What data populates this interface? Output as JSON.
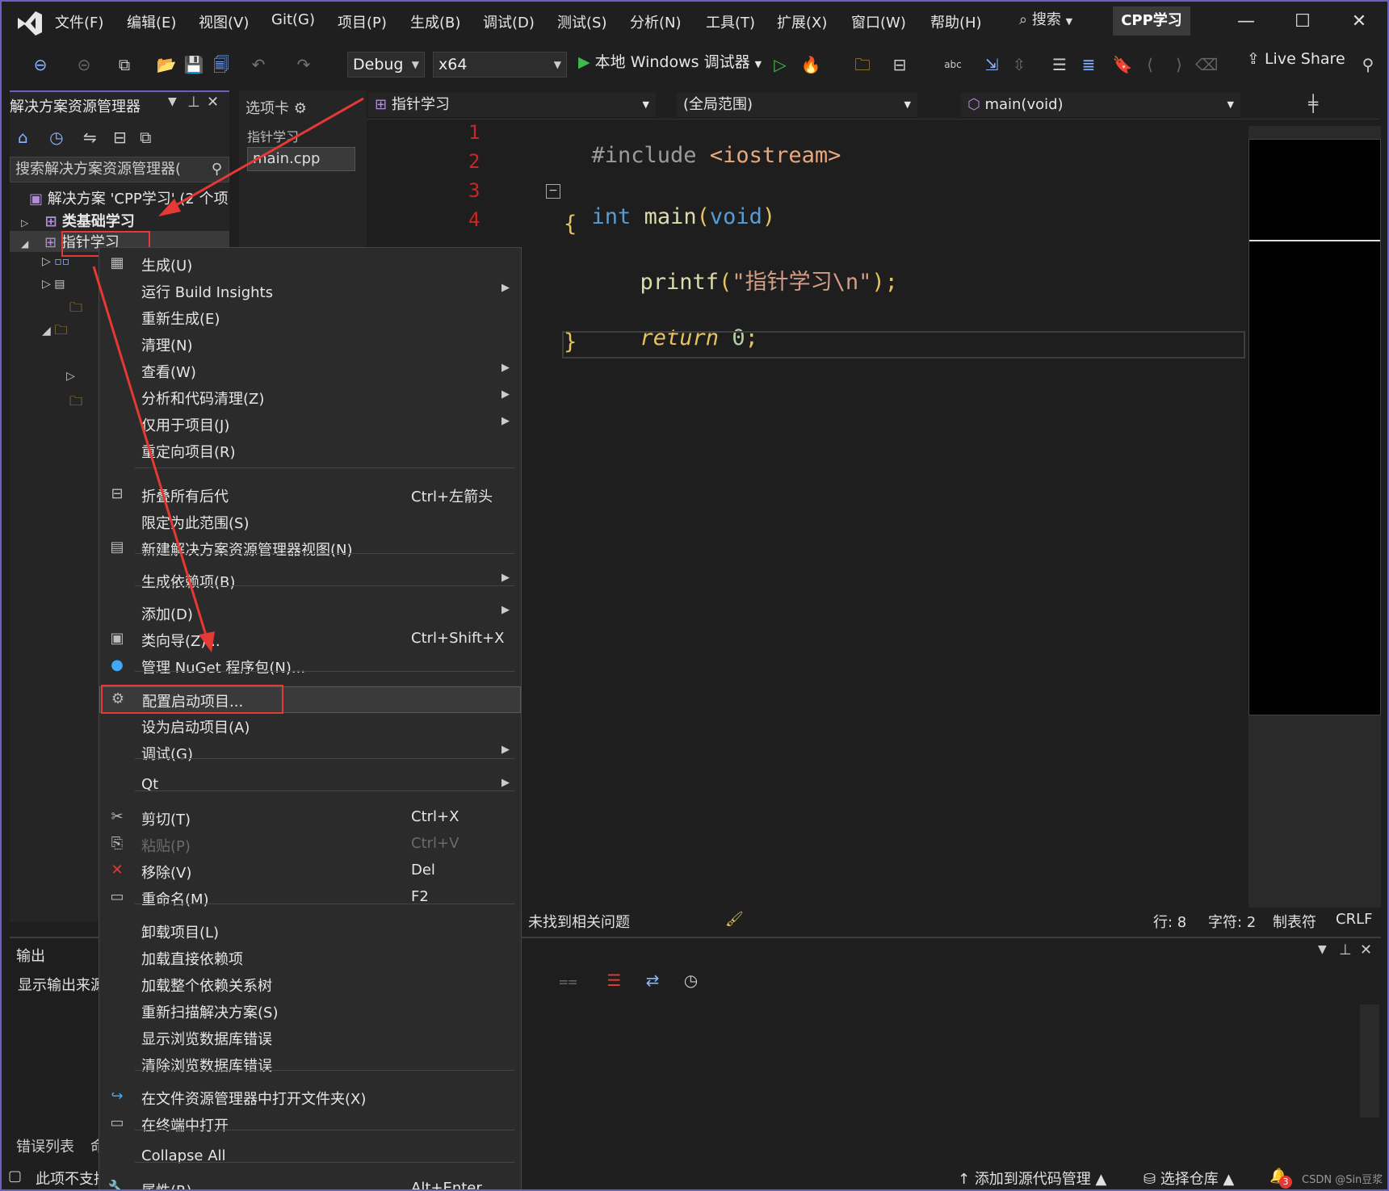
{
  "menu": [
    "文件(F)",
    "编辑(E)",
    "视图(V)",
    "Git(G)",
    "项目(P)",
    "生成(B)",
    "调试(D)",
    "测试(S)",
    "分析(N)",
    "工具(T)",
    "扩展(X)",
    "窗口(W)",
    "帮助(H)"
  ],
  "search_label": "搜索",
  "project_badge": "CPP学习",
  "toolbar": {
    "config": "Debug",
    "platform": "x64",
    "run_label": "本地 Windows 调试器",
    "live_share": "Live Share"
  },
  "solution_explorer": {
    "title": "解决方案资源管理器",
    "search_placeholder": "搜索解决方案资源管理器(",
    "solution_label": "解决方案 'CPP学习' (2 个项",
    "project1": "类基础学习",
    "project2": "指针学习"
  },
  "tab_panel": {
    "title": "选项卡",
    "group": "指针学习",
    "file": "main.cpp"
  },
  "nav": {
    "file": "指针学习",
    "scope": "(全局范围)",
    "member": "main(void)"
  },
  "code": {
    "line1_directive": "#include",
    "line1_header": "<iostream>",
    "line3_kw": "int",
    "line3_fn": "main",
    "line3_param": "void",
    "line4": "{",
    "line5_fn": "printf",
    "line5_str": "\"指针学习\\n\"",
    "line7_kw": "return",
    "line7_num": "0",
    "line8": "}",
    "line_numbers": [
      "1",
      "2",
      "3",
      "4"
    ]
  },
  "editor_status": {
    "issues": "未找到相关问题",
    "line": "行: 8",
    "char": "字符: 2",
    "tab": "制表符",
    "eol": "CRLF"
  },
  "output": {
    "title": "输出",
    "source_label": "显示输出来源"
  },
  "bottom_tabs": [
    "错误列表",
    "命"
  ],
  "statusbar": {
    "left": "此项不支持",
    "add_source": "添加到源代码管理",
    "select_repo": "选择仓库",
    "notif_count": "3",
    "watermark": "CSDN @Sin豆浆"
  },
  "context_menu": {
    "items": [
      {
        "label": "生成(U)",
        "shortcut": "",
        "sub": false
      },
      {
        "label": "运行 Build Insights",
        "shortcut": "",
        "sub": true
      },
      {
        "label": "重新生成(E)",
        "shortcut": "",
        "sub": false
      },
      {
        "label": "清理(N)",
        "shortcut": "",
        "sub": false
      },
      {
        "label": "查看(W)",
        "shortcut": "",
        "sub": true
      },
      {
        "label": "分析和代码清理(Z)",
        "shortcut": "",
        "sub": true
      },
      {
        "label": "仅用于项目(J)",
        "shortcut": "",
        "sub": true
      },
      {
        "label": "重定向项目(R)",
        "shortcut": "",
        "sub": false
      },
      {
        "label": "折叠所有后代",
        "shortcut": "Ctrl+左箭头",
        "sub": false
      },
      {
        "label": "限定为此范围(S)",
        "shortcut": "",
        "sub": false
      },
      {
        "label": "新建解决方案资源管理器视图(N)",
        "shortcut": "",
        "sub": false
      },
      {
        "label": "生成依赖项(B)",
        "shortcut": "",
        "sub": true
      },
      {
        "label": "添加(D)",
        "shortcut": "",
        "sub": true
      },
      {
        "label": "类向导(Z)...",
        "shortcut": "Ctrl+Shift+X",
        "sub": false
      },
      {
        "label": "管理 NuGet 程序包(N)...",
        "shortcut": "",
        "sub": false
      },
      {
        "label": "配置启动项目...",
        "shortcut": "",
        "sub": false
      },
      {
        "label": "设为启动项目(A)",
        "shortcut": "",
        "sub": false
      },
      {
        "label": "调试(G)",
        "shortcut": "",
        "sub": true
      },
      {
        "label": "Qt",
        "shortcut": "",
        "sub": true
      },
      {
        "label": "剪切(T)",
        "shortcut": "Ctrl+X",
        "sub": false
      },
      {
        "label": "粘贴(P)",
        "shortcut": "Ctrl+V",
        "sub": false
      },
      {
        "label": "移除(V)",
        "shortcut": "Del",
        "sub": false
      },
      {
        "label": "重命名(M)",
        "shortcut": "F2",
        "sub": false
      },
      {
        "label": "卸载项目(L)",
        "shortcut": "",
        "sub": false
      },
      {
        "label": "加载直接依赖项",
        "shortcut": "",
        "sub": false
      },
      {
        "label": "加载整个依赖关系树",
        "shortcut": "",
        "sub": false
      },
      {
        "label": "重新扫描解决方案(S)",
        "shortcut": "",
        "sub": false
      },
      {
        "label": "显示浏览数据库错误",
        "shortcut": "",
        "sub": false
      },
      {
        "label": "清除浏览数据库错误",
        "shortcut": "",
        "sub": false
      },
      {
        "label": "在文件资源管理器中打开文件夹(X)",
        "shortcut": "",
        "sub": false
      },
      {
        "label": "在终端中打开",
        "shortcut": "",
        "sub": false
      },
      {
        "label": "Collapse All",
        "shortcut": "",
        "sub": false
      },
      {
        "label": "属性(R)",
        "shortcut": "Alt+Enter",
        "sub": false
      }
    ]
  },
  "colors": {
    "accent": "#6b5fc2",
    "highlight_red": "#e53935",
    "keyword": "#569cd6",
    "function": "#dcdcaa",
    "string": "#d69d85",
    "preproc": "#9b9b9b",
    "include_header": "#e8a87c"
  }
}
